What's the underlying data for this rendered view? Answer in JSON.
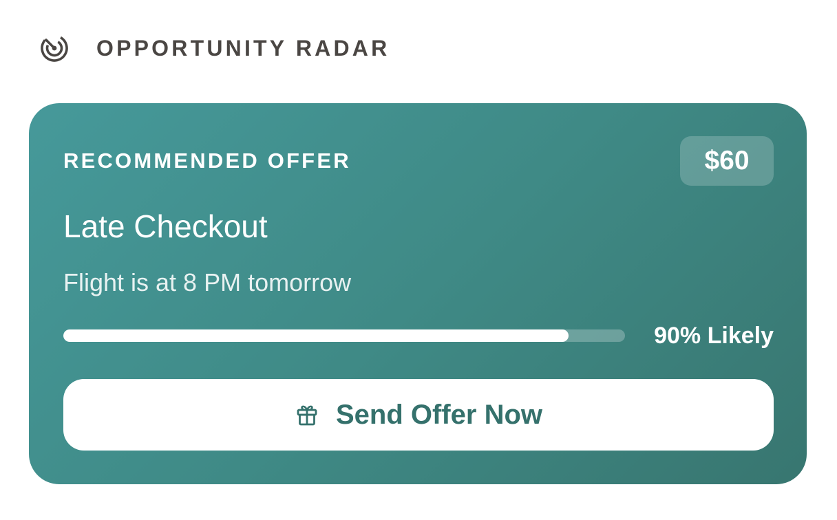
{
  "header": {
    "icon": "radar-icon",
    "title": "OPPORTUNITY RADAR"
  },
  "offer_card": {
    "label": "RECOMMENDED OFFER",
    "price": "$60",
    "offer_name": "Late Checkout",
    "reason": "Flight is at 8 PM tomorrow",
    "likelihood_fraction": 0.9,
    "likelihood_text": "90% Likely",
    "cta_icon": "gift-icon",
    "cta_label": "Send Offer Now",
    "colors": {
      "card_gradient_start": "#46999a",
      "card_gradient_end": "#387670",
      "cta_text": "#35716c",
      "header_text": "#4a4643"
    }
  }
}
